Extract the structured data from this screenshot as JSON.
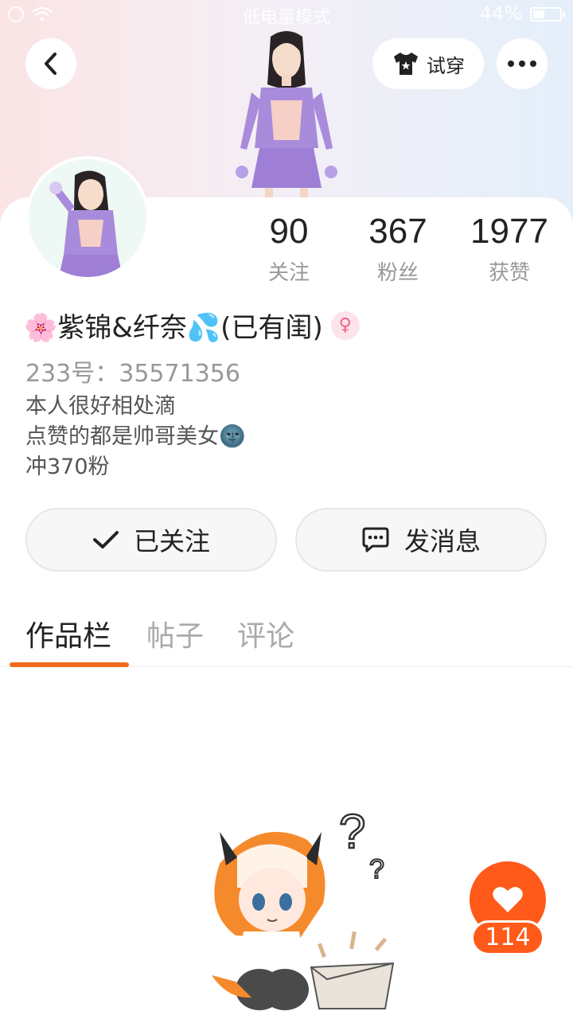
{
  "status_bar": {
    "mode_text": "低电量模式",
    "battery_text": "44%"
  },
  "header": {
    "tryon_label": "试穿"
  },
  "profile": {
    "nickname": "🌸紫锦&纤奈💦(已有闺)",
    "gender": "female",
    "uid_text": "233号：35571356",
    "bio_lines": [
      "本人很好相处滴",
      "点赞的都是帅哥美女🌚",
      "冲370粉"
    ]
  },
  "stats": [
    {
      "value": "90",
      "label": "关注"
    },
    {
      "value": "367",
      "label": "粉丝"
    },
    {
      "value": "1977",
      "label": "获赞"
    }
  ],
  "actions": {
    "follow_label": "已关注",
    "message_label": "发消息"
  },
  "tabs": [
    {
      "label": "作品栏",
      "active": true
    },
    {
      "label": "帖子",
      "active": false
    },
    {
      "label": "评论",
      "active": false
    }
  ],
  "floating_like": {
    "count": "114"
  },
  "colors": {
    "accent": "#f06a1e",
    "like_button": "#ff5a1a",
    "gender_badge_bg": "#fde3ea",
    "gender_badge_fg": "#ef5f8d"
  }
}
